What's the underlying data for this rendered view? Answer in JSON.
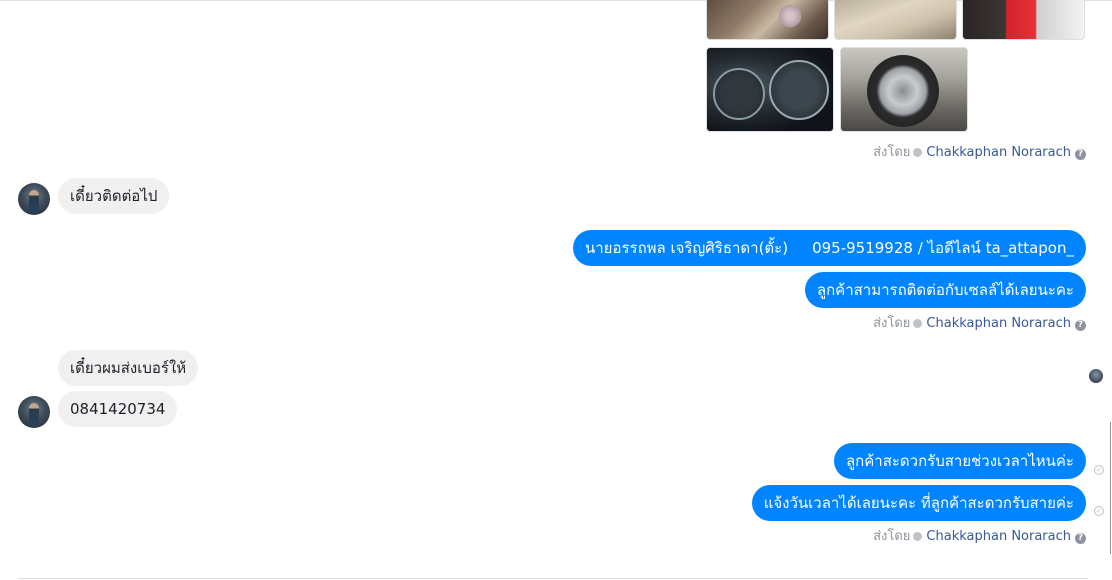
{
  "thread": {
    "sent_by_label": "ส่งโดย",
    "agent_name": "Chakkaphan Norarach",
    "help_icon": "question-circle-icon",
    "check_icon": "check-circle-icon",
    "seen_icon": "seen-check-icon"
  },
  "colors": {
    "outgoing_bubble": "#0084ff",
    "incoming_bubble": "#f1f0f0",
    "agent_link": "#385898",
    "meta_text": "#90949c"
  },
  "messages": {
    "incoming_1": "เดี๋ยวติดต่อไป",
    "outgoing_1_name": "นายอรรถพล เจริญศิริธาดา(ตั้ะ)",
    "outgoing_1_contact": "095-9519928 / ไอดีไลน์ ta_attapon_",
    "outgoing_2": "ลูกค้าสามารถติดต่อกับเซลล์ได้เลยนะคะ",
    "incoming_2": "เดี๋ยวผมส่งเบอร์ให้",
    "incoming_3": "0841420734",
    "outgoing_3": "ลูกค้าสะดวกรับสายช่วงเวลาไหนค่ะ",
    "outgoing_4": "แจ้งวันเวลาได้เลยนะคะ ที่ลูกค้าสะดวกรับสายค่ะ"
  }
}
